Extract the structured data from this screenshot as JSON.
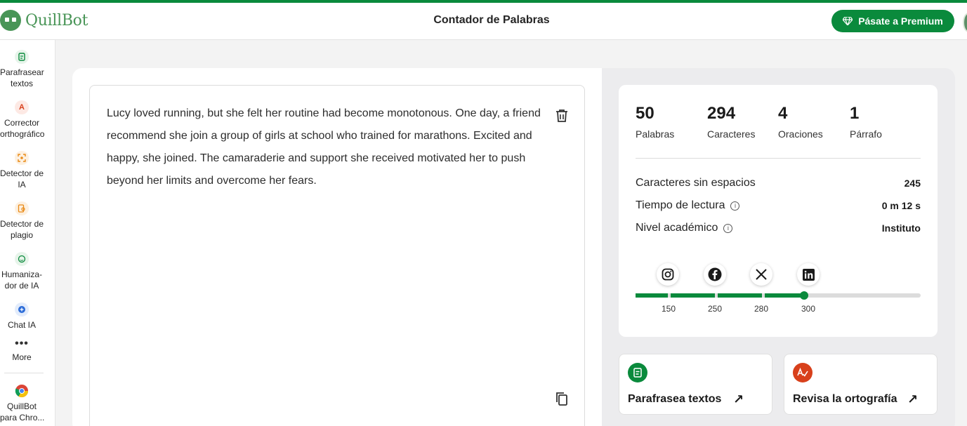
{
  "app": {
    "logo_text": "QuillBot",
    "page_title": "Contador de Palabras",
    "premium_label": "Pásate a Premium"
  },
  "sidebar": {
    "items": [
      {
        "label": "Parafrasear\ntextos",
        "icon": "paraphrase-icon"
      },
      {
        "label": "Corrector\northográfico",
        "icon": "grammar-check-icon"
      },
      {
        "label": "Detector de\nIA",
        "icon": "ai-detector-icon"
      },
      {
        "label": "Detector de\nplagio",
        "icon": "plagiarism-icon"
      },
      {
        "label": "Humaniza-\ndor de IA",
        "icon": "humanizer-icon"
      },
      {
        "label": "Chat IA",
        "icon": "chat-icon"
      },
      {
        "label": "More",
        "icon": "more-dots-icon"
      },
      {
        "label": "QuillBot\npara Chro...",
        "icon": "chrome-icon"
      }
    ]
  },
  "editor": {
    "text": "Lucy loved running, but she felt her routine had become monotonous. One day, a friend recommend she join a group of girls at school who trained for marathons. Excited and happy, she joined. The camaraderie and support she received motivated her to push beyond her limits and overcome her fears."
  },
  "stats": {
    "words": {
      "value": "50",
      "label": "Palabras"
    },
    "characters": {
      "value": "294",
      "label": "Caracteres"
    },
    "sentences": {
      "value": "4",
      "label": "Oraciones"
    },
    "paragraphs": {
      "value": "1",
      "label": "Párrafo"
    }
  },
  "details": [
    {
      "label": "Caracteres sin espacios",
      "value": "245",
      "info": false
    },
    {
      "label": "Tiempo de lectura",
      "value": "0 m 12 s",
      "info": true
    },
    {
      "label": "Nivel académico",
      "value": "Instituto",
      "info": true
    }
  ],
  "social_limits": {
    "platforms": [
      "instagram-icon",
      "facebook-icon",
      "x-icon",
      "linkedin-icon"
    ],
    "ticks": [
      "150",
      "250",
      "280",
      "300"
    ],
    "max": 3000,
    "current_words": 50,
    "colors": {
      "fill": "#0a8a3c",
      "track": "#dcdcdc"
    }
  },
  "actions": [
    {
      "label": "Parafrasea textos",
      "icon": "paraphrase-icon",
      "color": "#0a8a3c"
    },
    {
      "label": "Revisa la ortografía",
      "icon": "grammar-check-icon",
      "color": "#d8401b"
    }
  ],
  "colors": {
    "brand": "#0a8a3c",
    "logo": "#499557"
  }
}
